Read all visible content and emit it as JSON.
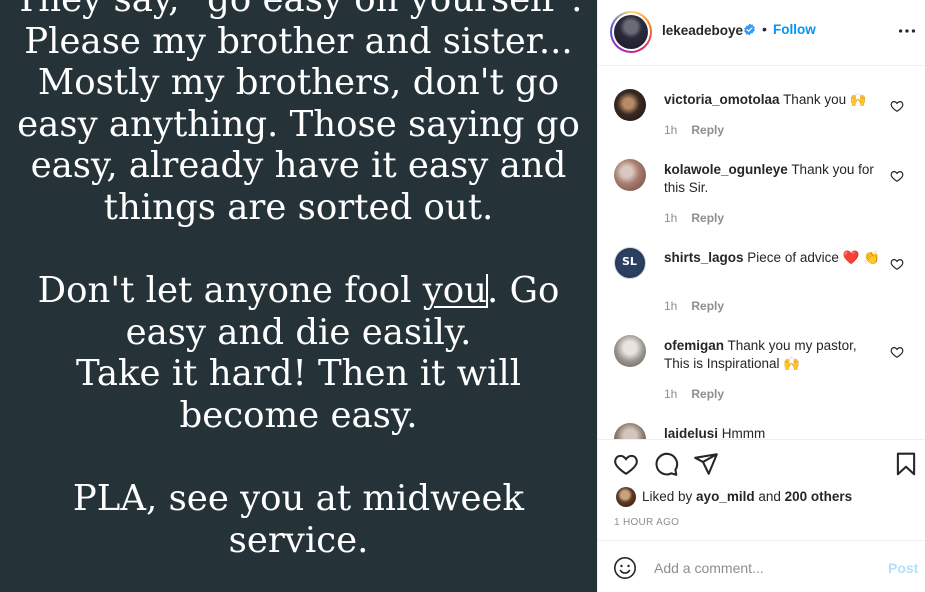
{
  "post_image": {
    "lines": [
      "They say, \"go easy on yourself\".",
      "Please my brother and sister...",
      "Mostly my brothers, don't go",
      "easy anything. Those saying go",
      "easy, already have it easy and",
      "things are sorted out.",
      "",
      "Don't let anyone fool ",
      "you",
      ". Go",
      "easy and die easily.",
      "Take it hard! Then it will",
      "become easy.",
      "",
      "PLA, see you at midweek",
      "service."
    ],
    "background": "#253238"
  },
  "header": {
    "username": "lekeadeboye",
    "separator": "•",
    "follow_label": "Follow",
    "verified_icon": "verified-badge",
    "more_icon": "more-options"
  },
  "comments": [
    {
      "user": "victoria_omotolaa",
      "text": "Thank you 🙌",
      "time": "1h",
      "reply": "Reply"
    },
    {
      "user": "kolawole_ogunleye",
      "text": "Thank you for this Sir.",
      "time": "1h",
      "reply": "Reply"
    },
    {
      "user": "shirts_lagos",
      "text": "Piece of advice ❤️ 👏",
      "time": "1h",
      "reply": "Reply"
    },
    {
      "user": "ofemigan",
      "text": "Thank you my pastor, This is Inspirational 🙌",
      "time": "1h",
      "reply": "Reply"
    },
    {
      "user": "laidelusi",
      "text": "Hmmm",
      "time": "",
      "reply": ""
    }
  ],
  "likes": {
    "prefix": "Liked by ",
    "user": "ayo_mild",
    "middle": " and ",
    "others": "200 others"
  },
  "time_ago": "1 HOUR AGO",
  "comment_box": {
    "placeholder": "Add a comment...",
    "post_label": "Post"
  },
  "colors": {
    "accent": "#0095f6",
    "post_disabled": "#b2dffc",
    "muted": "#8e8e8e",
    "text": "#262626"
  }
}
